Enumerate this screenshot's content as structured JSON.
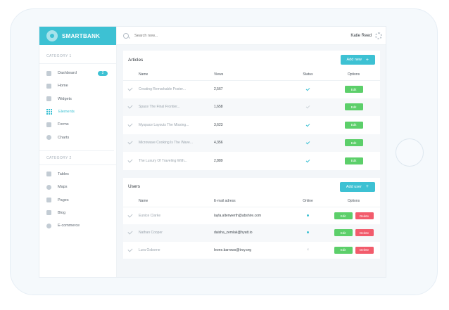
{
  "app": {
    "brand": "SMARTBANK"
  },
  "sidebar": {
    "category1": "CATEGORY 1",
    "category2": "CATEGORY 2",
    "items1": [
      {
        "label": "Dashboard",
        "badge": "2",
        "icon": "dashboard-icon"
      },
      {
        "label": "Home",
        "icon": "home-icon"
      },
      {
        "label": "Widgets",
        "icon": "widgets-icon"
      },
      {
        "label": "Elements",
        "icon": "grid-icon",
        "active": true
      },
      {
        "label": "Forms",
        "icon": "forms-icon"
      },
      {
        "label": "Charts",
        "icon": "pie-chart-icon"
      }
    ],
    "items2": [
      {
        "label": "Tables",
        "icon": "table-icon"
      },
      {
        "label": "Maps",
        "icon": "globe-icon"
      },
      {
        "label": "Pages",
        "icon": "pages-icon"
      },
      {
        "label": "Blog",
        "icon": "blog-icon"
      },
      {
        "label": "E-commerce",
        "icon": "ecommerce-icon"
      }
    ]
  },
  "topbar": {
    "search_placeholder": "Search now...",
    "user": "Katie Reed"
  },
  "articles": {
    "title": "Articles",
    "add_label": "Add new",
    "columns": {
      "name": "Name",
      "views": "Views",
      "status": "Status",
      "options": "Options"
    },
    "edit_label": "Edit",
    "rows": [
      {
        "name": "Creating Remarkable Poster...",
        "views": "2,567",
        "status": "on"
      },
      {
        "name": "Space The Final Frontier...",
        "views": "1,658",
        "status": "off"
      },
      {
        "name": "Myspace Layouts The Missing...",
        "views": "3,623",
        "status": "on"
      },
      {
        "name": "Microwave Cooking Is The Wave...",
        "views": "4,356",
        "status": "on"
      },
      {
        "name": "The Luxury Of Traveling With...",
        "views": "2,889",
        "status": "on"
      }
    ]
  },
  "users": {
    "title": "Users",
    "add_label": "Add user",
    "columns": {
      "name": "Name",
      "email": "E-mail adress",
      "online": "Online",
      "options": "Options"
    },
    "edit_label": "Edit",
    "delete_label": "Delete",
    "rows": [
      {
        "name": "Eunice Clarke",
        "email": "layla.altenwerth@abshire.com",
        "online": true
      },
      {
        "name": "Nathan Cooper",
        "email": "daisha_zemlak@hyatt.io",
        "online": true
      },
      {
        "name": "Lura Osborne",
        "email": "leone.barrows@troy.org",
        "online": false
      }
    ]
  },
  "colors": {
    "accent": "#3dc1d3",
    "edit": "#5ccf6a",
    "delete": "#f25c6c"
  }
}
